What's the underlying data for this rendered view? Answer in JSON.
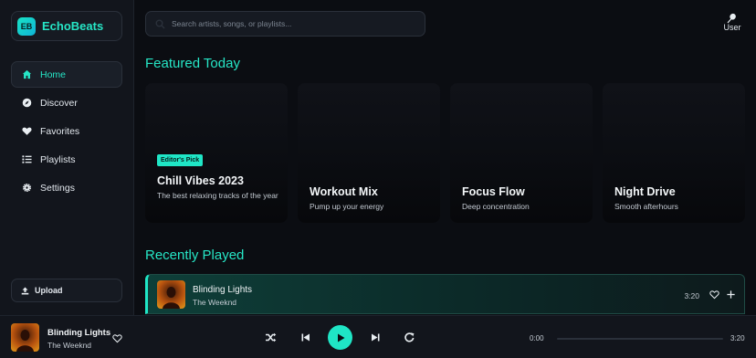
{
  "app": {
    "logo_text": "EB",
    "name": "EchoBeats"
  },
  "sidebar": {
    "items": [
      {
        "label": "Home",
        "icon": "home-icon",
        "active": true
      },
      {
        "label": "Discover",
        "icon": "compass-icon",
        "active": false
      },
      {
        "label": "Favorites",
        "icon": "heart-icon",
        "active": false
      },
      {
        "label": "Playlists",
        "icon": "list-icon",
        "active": false
      },
      {
        "label": "Settings",
        "icon": "gear-icon",
        "active": false
      }
    ],
    "upload_label": "Upload"
  },
  "header": {
    "search_placeholder": "Search artists, songs, or playlists...",
    "user_label": "User"
  },
  "featured": {
    "title": "Featured Today",
    "cards": [
      {
        "badge": "Editor's Pick",
        "title": "Chill Vibes 2023",
        "desc": "The best relaxing tracks of the year"
      },
      {
        "title": "Workout Mix",
        "desc": "Pump up your energy"
      },
      {
        "title": "Focus Flow",
        "desc": "Deep concentration"
      },
      {
        "title": "Night Drive",
        "desc": "Smooth afterhours"
      }
    ]
  },
  "recent": {
    "title": "Recently Played",
    "rows": [
      {
        "title": "Blinding Lights",
        "artist": "The Weeknd",
        "duration": "3:20"
      }
    ]
  },
  "player": {
    "title": "Blinding Lights",
    "artist": "The Weeknd",
    "current_time": "0:00",
    "total_time": "3:20",
    "progress": 0
  },
  "colors": {
    "accent": "#1fe6c6",
    "background": "#0b0d12",
    "panel": "#12151c"
  }
}
